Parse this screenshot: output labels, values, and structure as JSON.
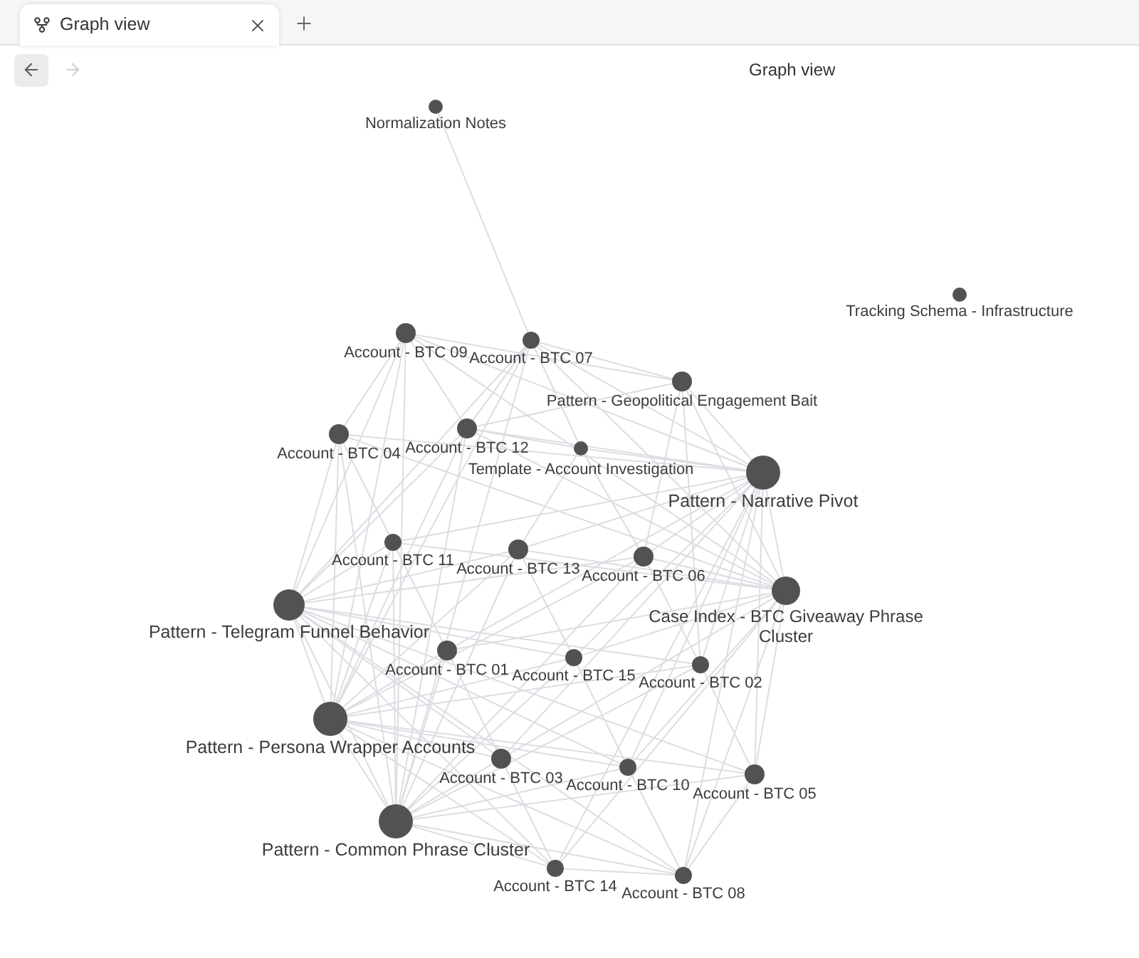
{
  "tabs": [
    {
      "label": "Graph view",
      "selected": true
    }
  ],
  "navigation": [
    {
      "kind": "back",
      "disabled": false
    },
    {
      "kind": "forward",
      "disabled": true
    }
  ],
  "view_header": {
    "title": "Graph view"
  },
  "graph": {
    "nodes": [
      {
        "label": "Normalization Notes"
      },
      {
        "label": "Tracking Schema - Infrastructure"
      },
      {
        "label": "Account - BTC 09"
      },
      {
        "label": "Account - BTC 07"
      },
      {
        "label": "Pattern - Geopolitical Engagement Bait"
      },
      {
        "label": "Account - BTC 04"
      },
      {
        "label": "Account - BTC 12"
      },
      {
        "label": "Template - Account Investigation"
      },
      {
        "label": "Pattern - Narrative Pivot"
      },
      {
        "label": "Account - BTC 11"
      },
      {
        "label": "Account - BTC 13"
      },
      {
        "label": "Account - BTC 06"
      },
      {
        "label": "Pattern - Telegram Funnel Behavior"
      },
      {
        "label": "Case Index - BTC Giveaway Phrase Cluster"
      },
      {
        "label": "Account - BTC 01"
      },
      {
        "label": "Account - BTC 15"
      },
      {
        "label": "Account - BTC 02"
      },
      {
        "label": "Pattern - Persona Wrapper Accounts"
      },
      {
        "label": "Account - BTC 03"
      },
      {
        "label": "Account - BTC 10"
      },
      {
        "label": "Account - BTC 05"
      },
      {
        "label": "Pattern - Common Phrase Cluster"
      },
      {
        "label": "Account - BTC 14"
      },
      {
        "label": "Account - BTC 08"
      }
    ]
  }
}
